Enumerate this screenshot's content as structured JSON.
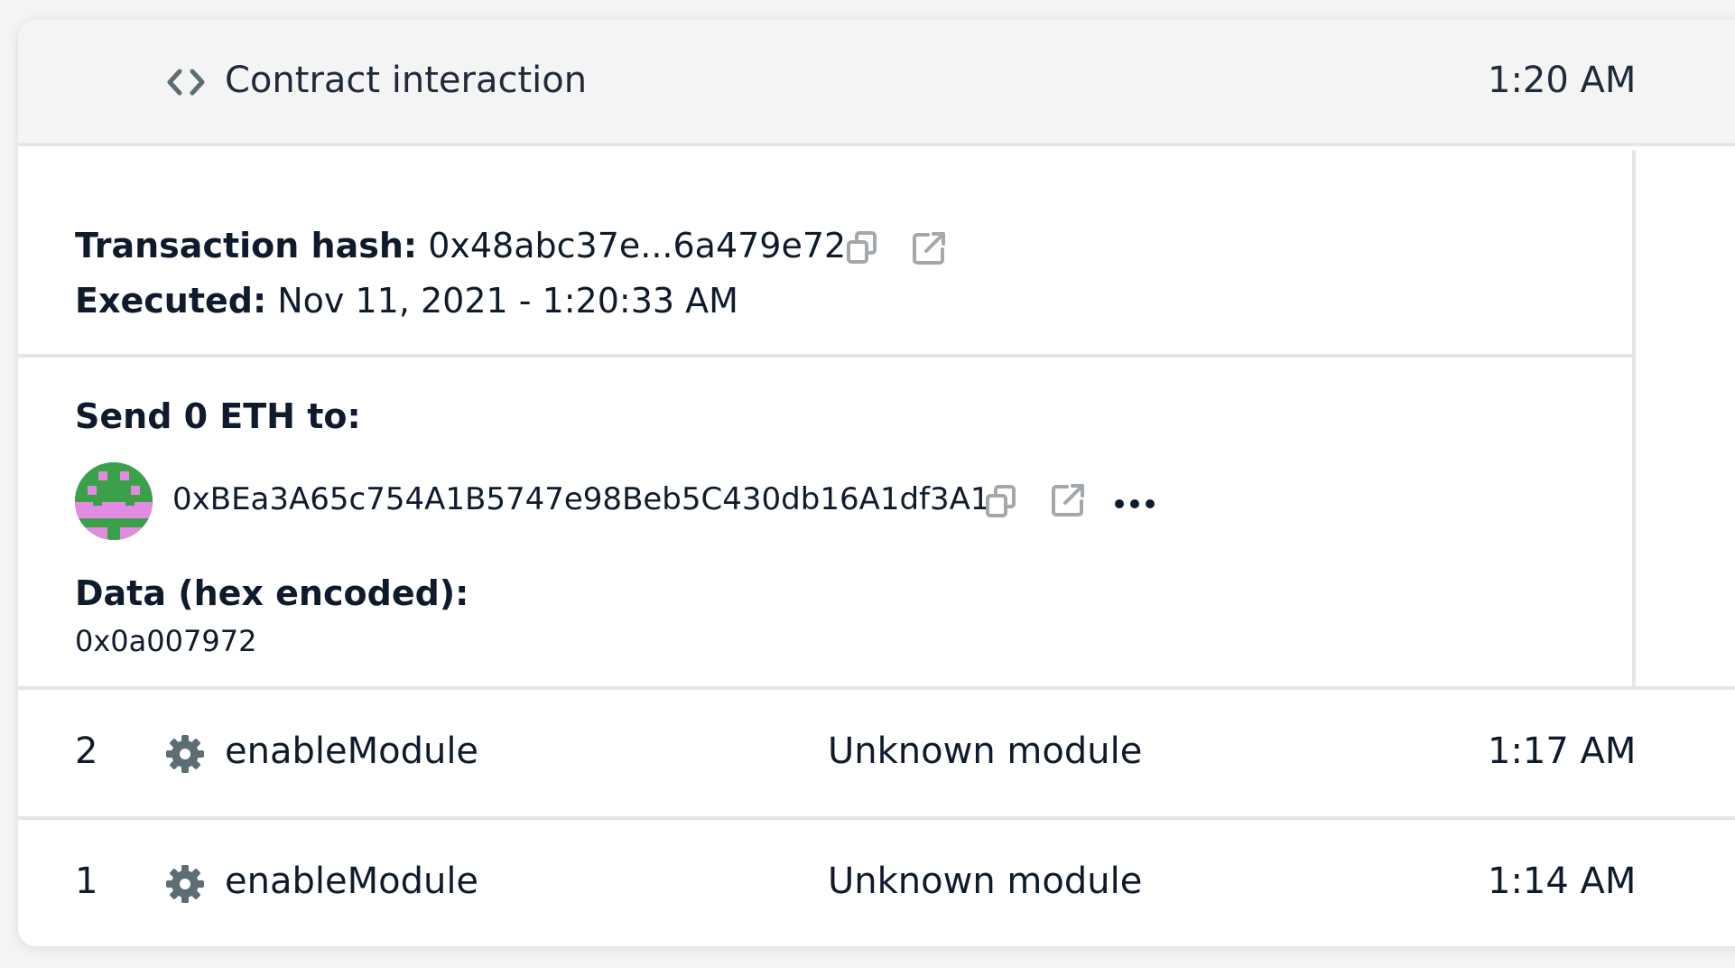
{
  "header": {
    "icon": "code-icon",
    "title": "Contract interaction",
    "time": "1:20 AM"
  },
  "transaction": {
    "hash_label": "Transaction hash:",
    "hash_value": "0x48abc37e...6a479e72",
    "executed_label": "Executed:",
    "executed_value": "Nov 11, 2021 - 1:20:33 AM"
  },
  "send": {
    "label": "Send 0 ETH to:",
    "address": "0xBEa3A65c754A1B5747e98Beb5C430db16A1df3A1",
    "data_label": "Data (hex encoded):",
    "data_value": "0x0a007972"
  },
  "rows": [
    {
      "nonce": "2",
      "icon": "gear-icon",
      "method": "enableModule",
      "info": "Unknown module",
      "time": "1:17 AM"
    },
    {
      "nonce": "1",
      "icon": "gear-icon",
      "method": "enableModule",
      "info": "Unknown module",
      "time": "1:14 AM"
    }
  ],
  "colors": {
    "header_bg": "#f5f4f5",
    "divider": "#e6e6e8",
    "text": "#0f1b2d",
    "icon_gray": "#5d6d74",
    "avatar_green": "#3aa14a",
    "avatar_pink": "#e38be0"
  }
}
